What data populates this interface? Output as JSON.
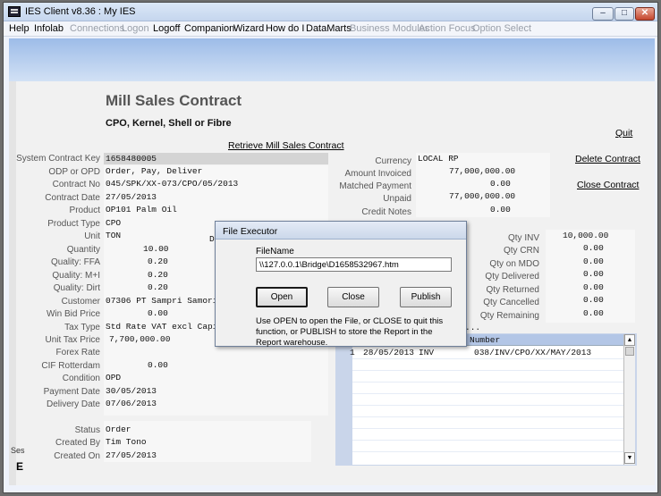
{
  "window": {
    "title": "IES Client v8.36 : My IES",
    "min_label": "–",
    "max_label": "□",
    "close_label": "✕"
  },
  "menu": {
    "items": [
      {
        "label": "Help",
        "enabled": true
      },
      {
        "label": "Infolab",
        "enabled": true
      },
      {
        "label": "Connections",
        "enabled": false
      },
      {
        "label": "Logon",
        "enabled": false
      },
      {
        "label": "Logoff",
        "enabled": true
      },
      {
        "label": "Companion",
        "enabled": true
      },
      {
        "label": "Wizard",
        "enabled": true
      },
      {
        "label": "How do I",
        "enabled": true
      },
      {
        "label": "DataMarts",
        "enabled": true
      },
      {
        "label": "Business Modules",
        "enabled": false
      },
      {
        "label": "Action Focus",
        "enabled": false
      },
      {
        "label": "Option Select",
        "enabled": false
      }
    ]
  },
  "form": {
    "title": "Mill Sales Contract",
    "subtitle": "CPO, Kernel, Shell or Fibre",
    "quit": "Quit",
    "retrieve": "Retrieve Mill Sales Contract",
    "delete": "Delete Contract",
    "close_contract": "Close Contract"
  },
  "fields": {
    "system_contract_key": {
      "label": "System Contract Key",
      "value": "1658480005"
    },
    "odp_or_opd": {
      "label": "ODP or OPD",
      "value": "Order, Pay, Deliver"
    },
    "contract_no": {
      "label": "Contract No",
      "value": "045/SPK/XX-073/CPO/05/2013"
    },
    "contract_date": {
      "label": "Contract Date",
      "value": "27/05/2013"
    },
    "product": {
      "label": "Product",
      "value": "OP101 Palm Oil"
    },
    "product_type": {
      "label": "Product Type",
      "value": "CPO"
    },
    "unit": {
      "label": "Unit",
      "value": "TON",
      "extra": "D"
    },
    "quantity": {
      "label": "Quantity",
      "value": "10.00"
    },
    "quality_ffa": {
      "label": "Quality: FFA",
      "value": "0.20"
    },
    "quality_mi": {
      "label": "Quality: M+I",
      "value": "0.20"
    },
    "quality_dirt": {
      "label": "Quality: Dirt",
      "value": "0.20"
    },
    "customer": {
      "label": "Customer",
      "value": "07306 PT Sampri Samori"
    },
    "win_bid_price": {
      "label": "Win Bid Price",
      "value": "0.00"
    },
    "tax_type": {
      "label": "Tax Type",
      "value": "Std Rate VAT excl Capita"
    },
    "unit_tax_price": {
      "label": "Unit Tax Price",
      "value": "7,700,000.00"
    },
    "forex_rate": {
      "label": "Forex Rate",
      "value": ""
    },
    "cif_rotterdam": {
      "label": "CIF Rotterdam",
      "value": "0.00"
    },
    "condition": {
      "label": "Condition",
      "value": "OPD"
    },
    "payment_date": {
      "label": "Payment Date",
      "value": "30/05/2013"
    },
    "delivery_date": {
      "label": "Delivery Date",
      "value": "07/06/2013"
    },
    "status": {
      "label": "Status",
      "value": "Order"
    },
    "created_by": {
      "label": "Created By",
      "value": "Tim Tono"
    },
    "created_on": {
      "label": "Created On",
      "value": "27/05/2013"
    }
  },
  "right_fields": {
    "currency": {
      "label": "Currency",
      "value": "LOCAL RP"
    },
    "amount_invoiced": {
      "label": "Amount Invoiced",
      "value": "77,000,000.00"
    },
    "matched_payment": {
      "label": "Matched Payment",
      "value": "0.00"
    },
    "unpaid": {
      "label": "Unpaid",
      "value": "77,000,000.00"
    },
    "credit_notes": {
      "label": "Credit Notes",
      "value": "0.00"
    }
  },
  "qty_fields": {
    "qty_inv": {
      "label": "Qty INV",
      "value": "10,000.00"
    },
    "qty_crn": {
      "label": "Qty CRN",
      "value": "0.00"
    },
    "qty_on_mdo": {
      "label": "Qty on MDO",
      "value": "0.00"
    },
    "qty_delivered": {
      "label": "Qty Delivered",
      "value": "0.00"
    },
    "qty_returned": {
      "label": "Qty Returned",
      "value": "0.00"
    },
    "qty_cancelled": {
      "label": "Qty Cancelled",
      "value": "0.00"
    },
    "qty_remaining": {
      "label": "Qty Remaining",
      "value": "0.00"
    }
  },
  "grid": {
    "ellipsis": "...",
    "header_number": "Number",
    "rows": [
      {
        "idx": "1",
        "date": "28/05/2013",
        "type": "INV",
        "number": "038/INV/CPO/XX/MAY/2013"
      }
    ]
  },
  "dialog": {
    "title": "File Executor",
    "filename_label": "FileName",
    "filename_value": "\\\\127.0.0.1\\Bridge\\D1658532967.htm",
    "open": "Open",
    "close": "Close",
    "publish": "Publish",
    "hint": "Use OPEN to open the File, or CLOSE to quit this function, or PUBLISH to store the Report in the Report warehouse."
  },
  "session": {
    "ses_label": "Ses",
    "e_label": "E"
  }
}
